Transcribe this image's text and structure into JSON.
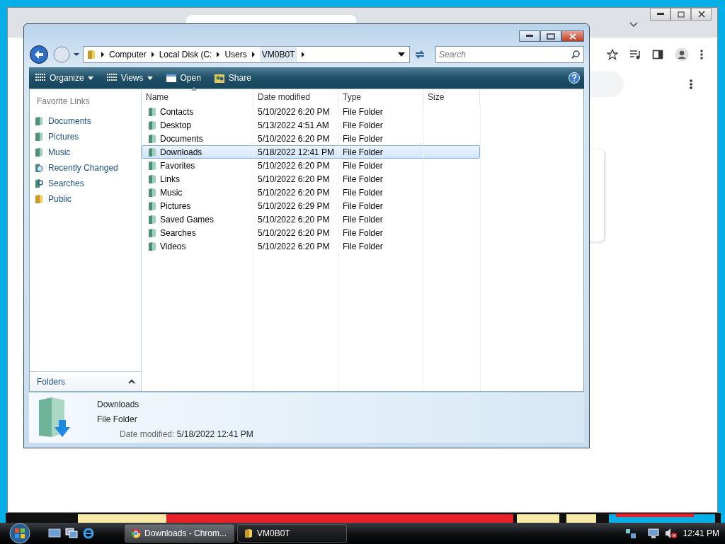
{
  "explorer": {
    "breadcrumb": [
      "Computer",
      "Local Disk (C:",
      "Users",
      "VM0B0T"
    ],
    "search": {
      "placeholder": "Search"
    },
    "toolbar": [
      {
        "label": "Organize",
        "kind": "menu"
      },
      {
        "label": "Views",
        "kind": "menu"
      },
      {
        "label": "Open",
        "kind": "open"
      },
      {
        "label": "Share",
        "kind": "share"
      }
    ],
    "favorite_links": {
      "title": "Favorite Links",
      "items": [
        {
          "label": "Documents",
          "kind": "doc"
        },
        {
          "label": "Pictures",
          "kind": "doc"
        },
        {
          "label": "Music",
          "kind": "doc"
        },
        {
          "label": "Recently Changed",
          "kind": "recent"
        },
        {
          "label": "Searches",
          "kind": "search"
        },
        {
          "label": "Public",
          "kind": "folder"
        }
      ]
    },
    "folders_label": "Folders",
    "columns": [
      {
        "label": "Name",
        "sorted": true
      },
      {
        "label": "Date modified",
        "sorted": false
      },
      {
        "label": "Type",
        "sorted": false
      },
      {
        "label": "Size",
        "sorted": false
      }
    ],
    "rows": [
      {
        "name": "Contacts",
        "date": "5/10/2022 6:20 PM",
        "type": "File Folder",
        "selected": false
      },
      {
        "name": "Desktop",
        "date": "5/13/2022 4:51 AM",
        "type": "File Folder",
        "selected": false
      },
      {
        "name": "Documents",
        "date": "5/10/2022 6:20 PM",
        "type": "File Folder",
        "selected": false
      },
      {
        "name": "Downloads",
        "date": "5/18/2022 12:41 PM",
        "type": "File Folder",
        "selected": true
      },
      {
        "name": "Favorites",
        "date": "5/10/2022 6:20 PM",
        "type": "File Folder",
        "selected": false
      },
      {
        "name": "Links",
        "date": "5/10/2022 6:20 PM",
        "type": "File Folder",
        "selected": false
      },
      {
        "name": "Music",
        "date": "5/10/2022 6:20 PM",
        "type": "File Folder",
        "selected": false
      },
      {
        "name": "Pictures",
        "date": "5/10/2022 6:29 PM",
        "type": "File Folder",
        "selected": false
      },
      {
        "name": "Saved Games",
        "date": "5/10/2022 6:20 PM",
        "type": "File Folder",
        "selected": false
      },
      {
        "name": "Searches",
        "date": "5/10/2022 6:20 PM",
        "type": "File Folder",
        "selected": false
      },
      {
        "name": "Videos",
        "date": "5/10/2022 6:20 PM",
        "type": "File Folder",
        "selected": false
      }
    ],
    "details": {
      "name": "Downloads",
      "type": "File Folder",
      "date_label": "Date modified:",
      "date": "5/18/2022 12:41 PM"
    }
  },
  "taskbar": {
    "tasks": [
      {
        "label": "Downloads - Chrom...",
        "kind": "chrome",
        "selected": true
      },
      {
        "label": "VM0B0T",
        "kind": "folder",
        "selected": false
      }
    ],
    "clock": "12:41 PM"
  }
}
